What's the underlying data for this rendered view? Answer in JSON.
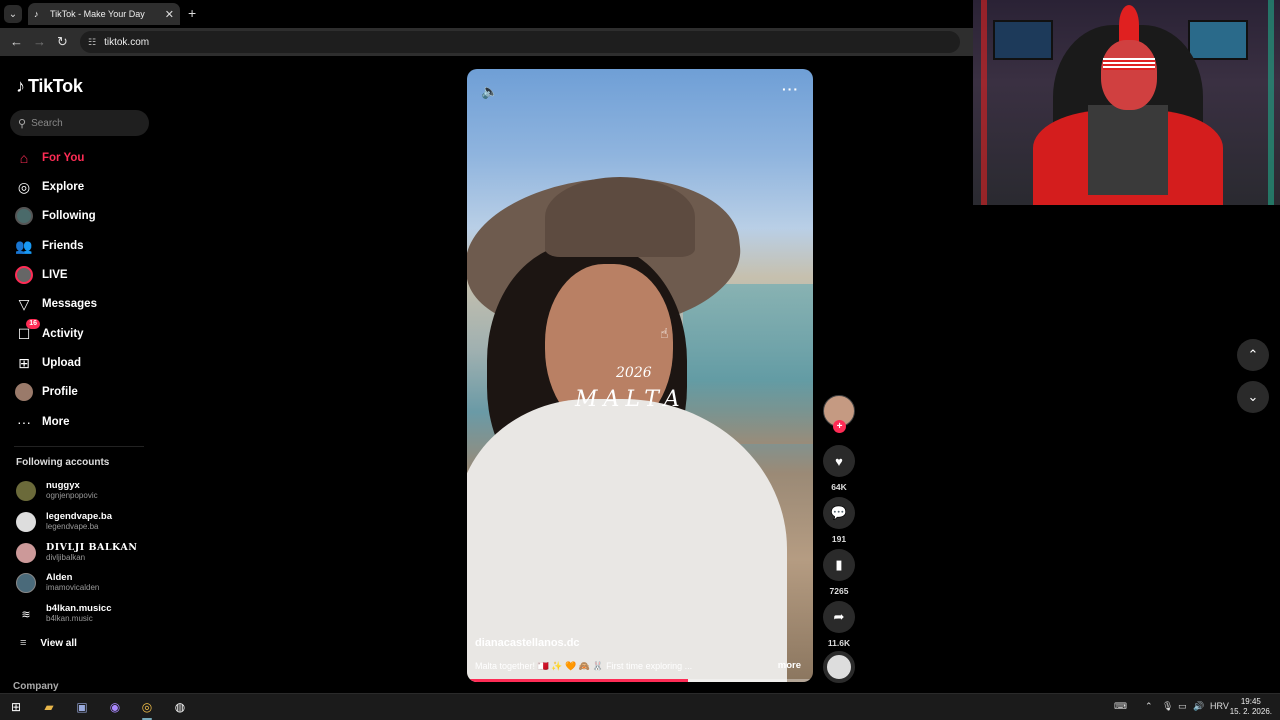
{
  "browser": {
    "tab_title": "TikTok - Make Your Day",
    "url": "tiktok.com"
  },
  "sidebar": {
    "brand": "TikTok",
    "search_placeholder": "Search",
    "nav": [
      {
        "label": "For You",
        "icon": "home-icon",
        "active": true
      },
      {
        "label": "Explore",
        "icon": "compass-icon"
      },
      {
        "label": "Following",
        "icon": "following-avatar-icon"
      },
      {
        "label": "Friends",
        "icon": "friends-icon"
      },
      {
        "label": "LIVE",
        "icon": "live-avatar-icon"
      },
      {
        "label": "Messages",
        "icon": "send-icon"
      },
      {
        "label": "Activity",
        "icon": "inbox-icon",
        "badge": "16"
      },
      {
        "label": "Upload",
        "icon": "plus-square-icon"
      },
      {
        "label": "Profile",
        "icon": "profile-avatar-icon"
      },
      {
        "label": "More",
        "icon": "more-dots-icon"
      }
    ],
    "following_title": "Following accounts",
    "accounts": [
      {
        "name": "nuggyx",
        "handle": "ognjenpopovic"
      },
      {
        "name": "legendvape.ba",
        "handle": "legendvape.ba"
      },
      {
        "name": "DIVLJI BALKAN",
        "handle": "divljibalkan"
      },
      {
        "name": "Alden",
        "handle": "imamovicalden"
      },
      {
        "name": "b4lkan.musicc",
        "handle": "b4lkan.music"
      }
    ],
    "view_all": "View all",
    "company": "Company"
  },
  "video": {
    "overlay_year": "2026",
    "overlay_place": "MALTA",
    "author": "dianacastellanos.dc",
    "caption": "Malta together! 🇲🇹 ✨ 🧡 🙈 🐰 First time exploring ...",
    "more": "more",
    "progress": 0.64
  },
  "actions": {
    "likes": "64K",
    "comments": "191",
    "saves": "7265",
    "shares": "11.6K"
  },
  "taskbar": {
    "lang": "HRV",
    "time": "19:45",
    "date": "15. 2. 2026."
  },
  "colors": {
    "accent": "#fe2c55",
    "background": "#000000"
  }
}
